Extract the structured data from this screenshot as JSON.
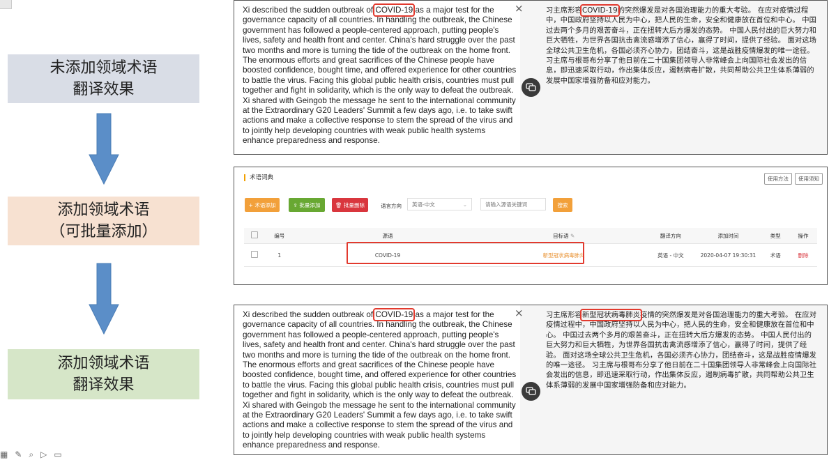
{
  "flow": {
    "step1": [
      "未添加领域术语",
      "翻译效果"
    ],
    "step2": [
      "添加领域术语",
      "（可批量添加）"
    ],
    "step3": [
      "添加领域术语",
      "翻译效果"
    ],
    "colors": {
      "step1": "#d9dde6",
      "step2": "#f7e1d1",
      "step3": "#d6e6c8",
      "arrow": "#5b8ec8",
      "highlight": "#e23a2e"
    }
  },
  "panel_before": {
    "close": "×",
    "src_pre": "Xi described the sudden outbreak of ",
    "src_term": "COVID-19",
    "src_post": " as a major test for the governance capacity of all countries. In handling the outbreak, the Chinese government has followed a people-centered approach, putting people's lives, safety and health front and center. China's hard struggle over the past two months and more is turning the tide of the outbreak on the home front. The enormous efforts and great sacrifices of the Chinese people have boosted confidence, bought time, and offered experience for other countries to battle the virus. Facing this global public health crisis, countries must pull together and fight in solidarity, which is the only way to defeat the outbreak. Xi shared with Geingob the message he sent to the international community at the Extraordinary G20 Leaders' Summit a few days ago, i.e. to take swift actions and make a collective response to stem the spread of the virus and to jointly help developing countries with weak public health systems enhance preparedness and response.",
    "tgt_pre": "习主席形容",
    "tgt_term": "COVID-19",
    "tgt_post": "的突然爆发是对各国治理能力的重大考验。 在应对疫情过程中，中国政府坚持以人民为中心，把人民的生命，安全和健康放在首位和中心。 中国过去两个多月的艰苦奋斗，正在扭转大后方爆发的态势。 中国人民付出的巨大努力和巨大牺牲，为世界各国抗击禽流感增添了信心，赢得了时间，提供了经验。 面对这场全球公共卫生危机，各国必须齐心协力，团结奋斗，这是战胜疫情爆发的唯一途径。 习主席与根哥布分享了他日前在二十国集团领导人非常峰会上向国际社会发出的信息，即迅速采取行动，作出集体反应，遏制病毒扩散，共同帮助公共卫生体系薄弱的发展中国家增强防备和应对能力。"
  },
  "dictionary": {
    "title": "术语词典",
    "top_btn1": "使用方法",
    "top_btn2": "使用须知",
    "add_btn": "+ 术语添加",
    "batch_add_btn": "⇪ 批量添加",
    "batch_del_btn": "🗑 批量删除",
    "lang_label": "语言方向",
    "lang_value": "英语-中文",
    "search_placeholder": "请输入源语关键词",
    "search_btn": "搜索",
    "headers": [
      "",
      "编号",
      "源语",
      "目标语",
      "翻译方向",
      "添加时间",
      "类型",
      "操作"
    ],
    "rows": [
      {
        "id": "1",
        "source": "COVID-19",
        "target": "新型冠状病毒肺炎",
        "direction": "英语 - 中文",
        "time": "2020-04-07 19:30:31",
        "type": "术语",
        "action": "删除"
      }
    ]
  },
  "panel_after": {
    "close": "×",
    "src_pre": "Xi described the sudden outbreak of ",
    "src_term": "COVID-19",
    "src_post": " as a major test for the governance capacity of all countries. In handling the outbreak, the Chinese government has followed a people-centered approach, putting people's lives, safety and health front and center. China's hard struggle over the past two months and more is turning the tide of the outbreak on the home front. The enormous efforts and great sacrifices of the Chinese people have boosted confidence, bought time, and offered experience for other countries to battle the virus. Facing this global public health crisis, countries must pull together and fight in solidarity, which is the only way to defeat the outbreak. Xi shared with Geingob the message he sent to the international community at the Extraordinary G20 Leaders' Summit a few days ago, i.e. to take swift actions and make a collective response to stem the spread of the virus and to jointly help developing countries with weak public health systems enhance preparedness and response.",
    "tgt_pre": "习主席形容",
    "tgt_term": "新型冠状病毒肺炎",
    "tgt_post": "疫情的突然爆发是对各国治理能力的重大考验。 在应对疫情过程中，中国政府坚持以人民为中心，把人民的生命，安全和健康放在首位和中心。 中国过去两个多月的艰苦奋斗，正在扭转大后方爆发的态势。 中国人民付出的巨大努力和巨大牺牲，为世界各国抗击禽流感增添了信心，赢得了时间，提供了经验。 面对这场全球公共卫生危机，各国必须齐心协力，团结奋斗，这是战胜疫情爆发的唯一途径。 习主席与根哥布分享了他日前在二十国集团领导人非常峰会上向国际社会发出的信息，即迅速采取行动，作出集体反应，遏制病毒扩散，共同帮助公共卫生体系薄弱的发展中国家增强防备和应对能力。"
  }
}
